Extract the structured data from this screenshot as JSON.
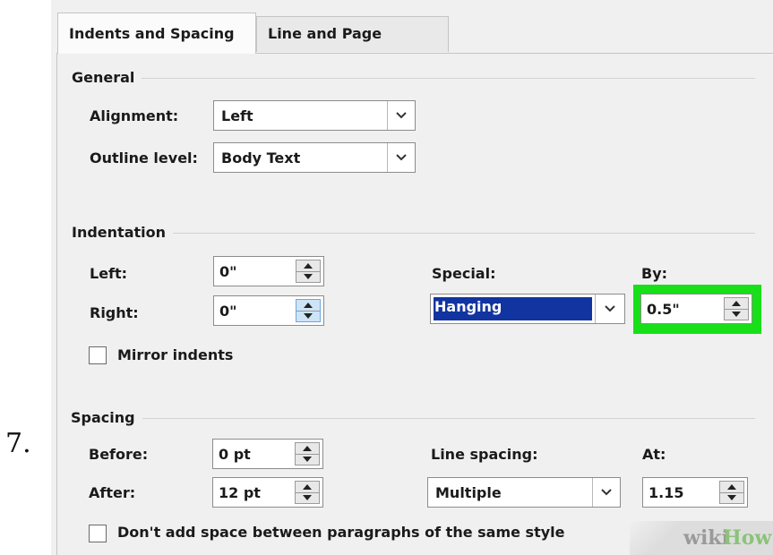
{
  "step_number": "7.",
  "tabs": [
    {
      "label": "Indents and Spacing",
      "active": true
    },
    {
      "label": "Line and Page Breaks",
      "active": false
    }
  ],
  "general": {
    "title": "General",
    "alignment_label": "Alignment:",
    "alignment_value": "Left",
    "outline_label": "Outline level:",
    "outline_value": "Body Text"
  },
  "indentation": {
    "title": "Indentation",
    "left_label": "Left:",
    "left_value": "0\"",
    "right_label": "Right:",
    "right_value": "0\"",
    "special_label": "Special:",
    "special_value": "Hanging",
    "by_label": "By:",
    "by_value": "0.5\"",
    "mirror_label": "Mirror indents",
    "mirror_checked": false,
    "highlight_color": "#18e018",
    "selection_color": "#1234a0"
  },
  "spacing": {
    "title": "Spacing",
    "before_label": "Before:",
    "before_value": "0 pt",
    "after_label": "After:",
    "after_value": "12 pt",
    "line_spacing_label": "Line spacing:",
    "line_spacing_value": "Multiple",
    "at_label": "At:",
    "at_value": "1.15",
    "dont_add_label": "Don't add space between paragraphs of the same style",
    "dont_add_checked": false
  },
  "watermark": {
    "part1": "wiki",
    "part2": "How"
  }
}
